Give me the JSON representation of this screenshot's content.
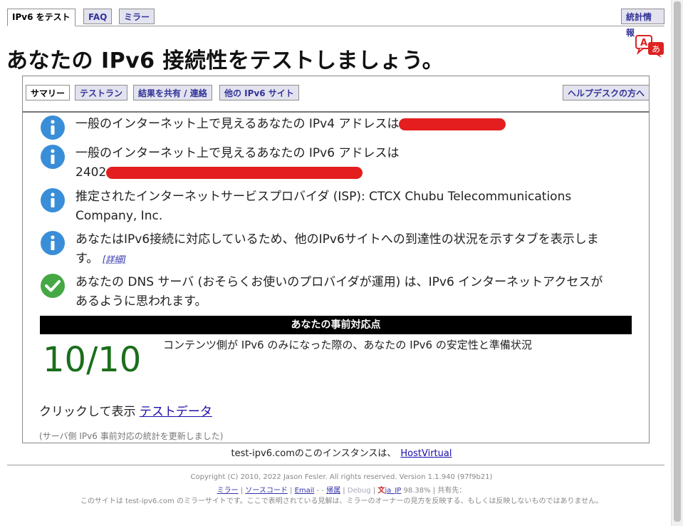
{
  "top_tabs": {
    "test": "IPv6 をテスト",
    "faq": "FAQ",
    "mirror": "ミラー",
    "stats": "統計情報"
  },
  "title": "あなたの IPv6 接続性をテストしましょう。",
  "sub_tabs": {
    "summary": "サマリー",
    "tests": "テストラン",
    "share": "結果を共有 / 連絡",
    "other": "他の IPv6 サイト",
    "helpdesk": "ヘルプデスクの方へ"
  },
  "items": {
    "ipv4": "一般のインターネット上で見えるあなたの IPv4 アドレスは",
    "ipv6": "一般のインターネット上で見えるあなたの IPv6 アドレスは",
    "ipv6_prefix": "2402",
    "isp": "推定されたインターネットサービスプロバイダ (ISP): CTCX Chubu Telecommunications Company, Inc.",
    "tabs_info": "あなたはIPv6接続に対応しているため、他のIPv6サイトへの到達性の状況を示すタブを表示します。",
    "details": "[詳細]",
    "dns": "あなたの DNS サーバ (おそらくお使いのプロバイダが運用) は、IPv6 インターネットアクセスがあるように思われます。"
  },
  "readiness": {
    "header": "あなたの事前対応点",
    "score": "10/10",
    "description": "コンテンツ側が IPv6 のみになった際の、あなたの IPv6 の安定性と準備状況"
  },
  "click": {
    "prefix": "クリックして表示",
    "link": "テストデータ"
  },
  "server_note": "(サーバ側 IPv6 事前対応の統計を更新しました)",
  "instance": {
    "text": "test-ipv6.comのこのインスタンスは、",
    "link": "HostVirtual"
  },
  "footer": {
    "copyright": "Copyright (C) 2010, 2022 Jason Fesler. All rights reserved. Version 1.1.940 (97f9b21)",
    "mirror": "ミラー",
    "source": "ソースコード",
    "email": "Email",
    "sep1": " - ",
    "attrib": "帰属",
    "debug": "Debug",
    "locale": "ja_JP",
    "percent": "98.38%",
    "share": "共有先：",
    "notice": "このサイトは test-ipv6.com のミラーサイトです。ここで表明されている見解は、ミラーのオーナーの見方を反映する、もしくは反映しないものではありません。"
  },
  "colors": {
    "tab_bg": "#e3e3ef",
    "tab_text": "#333399",
    "score_green": "#1b6e1b",
    "info_blue": "#3a8ed8",
    "check_green": "#45a845",
    "redact": "#e41e1e"
  }
}
